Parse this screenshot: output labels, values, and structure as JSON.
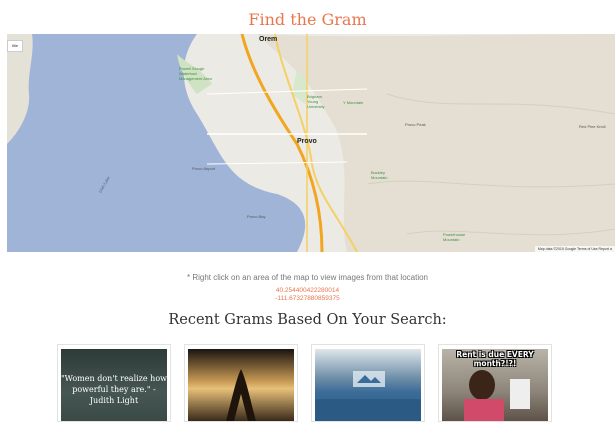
{
  "header": {
    "title": "Find the Gram"
  },
  "map": {
    "control_label": "title",
    "footer": "Map data ©2015 Google   Terms of Use   Report a",
    "labels": {
      "orem": "Orem",
      "provo": "Provo",
      "utah_lake": "Utah Lake",
      "byu": "Brigham Young University",
      "y_mountain": "Y Mountain",
      "provo_peak": "Provo Peak",
      "buckley": "Buckley Mountain",
      "red_pine": "Red Pine Knoll",
      "powell_slough": "Powell Slough Waterfowl Management Area",
      "provo_bay": "Provo Bay",
      "airport": "Provo Airport",
      "powerhouse": "Powerhouse Mountain"
    }
  },
  "instruction": "* Right click on an area of the map to view images from that location",
  "coords": {
    "lat": "40.254400422280014",
    "lng": "-111.67327880859375"
  },
  "recent": {
    "title": "Recent Grams Based On Your Search:"
  },
  "grams": [
    {
      "quote": "\"Women don't realize how powerful they are.\" - Judith Light"
    },
    {},
    {},
    {
      "meme": "Rent is due EVERY month?!?!"
    }
  ],
  "colors": {
    "accent": "#e8774f",
    "water": "#9fb4d6",
    "land": "#eceae4"
  }
}
